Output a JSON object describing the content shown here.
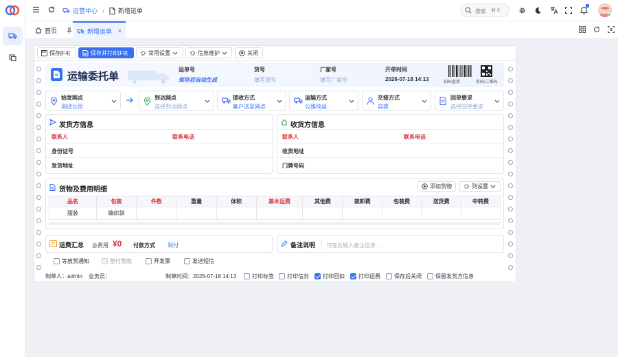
{
  "sidebar": {
    "logo": "app-logo",
    "items": [
      {
        "icon": "truck-icon",
        "active": true
      },
      {
        "icon": "copy-window-icon",
        "active": false
      }
    ]
  },
  "header": {
    "breadcrumb": [
      {
        "label": "运营中心",
        "icon": "truck-icon"
      },
      {
        "label": "新增运单",
        "icon": "document-icon"
      }
    ],
    "search_placeholder": "搜索",
    "search_shortcut": "⌘ K",
    "icons": [
      "gear-icon",
      "moon-icon",
      "translate-icon",
      "fullscreen-icon",
      "bell-icon",
      "avatar"
    ]
  },
  "tabs": [
    {
      "label": "首页",
      "icon": "home-icon",
      "active": false
    },
    {
      "label": "新增运单",
      "icon": "truck-icon",
      "active": true,
      "closable": true
    }
  ],
  "toolbar": {
    "save": "保存[F4]",
    "save_print": "保存并打印[F9]",
    "common_settings": "常用设置",
    "info_maintain": "信息维护",
    "close": "关闭"
  },
  "form": {
    "title": "运输委托单",
    "waybill_no": {
      "label": "运单号",
      "value": "保存后自动生成"
    },
    "goods_no": {
      "label": "货号",
      "placeholder": "填写货号"
    },
    "factory_no": {
      "label": "厂家号",
      "placeholder": "填写厂家号"
    },
    "open_time": {
      "label": "开单时间",
      "value": "2026-07-18 14:13"
    },
    "scan_label": "扫码查单",
    "barcode_label": "条码/二维码",
    "route": [
      {
        "label": "始发网点",
        "value": "测试公司",
        "placeholder": ""
      },
      {
        "label": "到达网点",
        "value": "",
        "placeholder": "选择到达网点"
      },
      {
        "label": "提收方式",
        "value": "客户送至网点",
        "placeholder": ""
      },
      {
        "label": "运输方式",
        "value": "公路快运",
        "placeholder": ""
      },
      {
        "label": "交接方式",
        "value": "自提",
        "placeholder": ""
      },
      {
        "label": "回单要求",
        "value": "",
        "placeholder": "选择回单要求"
      }
    ],
    "shipper": {
      "title": "发货方信息",
      "contact": "联系人",
      "phone": "联系电话",
      "id_card": "身份证号",
      "address": "发货地址"
    },
    "receiver": {
      "title": "收货方信息",
      "contact": "联系人",
      "phone": "联系电话",
      "address": "收货地址",
      "door_no": "门牌号码"
    },
    "goods": {
      "title": "货物及费用明细",
      "add_button": "添加货物",
      "column_settings": "列设置",
      "columns": [
        "品名",
        "包装",
        "件数",
        "重量",
        "体积",
        "基本运费",
        "其他费",
        "装卸费",
        "包装费",
        "送货费",
        "中转费"
      ],
      "required_columns": [
        0,
        1,
        2,
        5
      ],
      "rows": [
        [
          "服装",
          "编织袋",
          "",
          "",
          "",
          "",
          "",
          "",
          "",
          "",
          ""
        ]
      ]
    },
    "summary": {
      "title": "运费汇总",
      "total_label": "总费用",
      "total_value": "¥0",
      "pay_label": "付款方式",
      "pay_value": "到付"
    },
    "remark": {
      "title": "备注说明",
      "placeholder": "可在此输入备注信息..."
    },
    "options": [
      {
        "label": "等放货通知",
        "checked": false,
        "disabled": false
      },
      {
        "label": "垫付货款",
        "checked": false,
        "disabled": true
      },
      {
        "label": "开发票",
        "checked": false,
        "disabled": false
      },
      {
        "label": "发送短信",
        "checked": false,
        "disabled": false
      }
    ],
    "footer": {
      "creator": "制单人：admin",
      "salesman": "业务员：",
      "created_time": "制单时间：2026-07-18 14:13",
      "prints": [
        {
          "label": "打印标签",
          "checked": false
        },
        {
          "label": "打印信封",
          "checked": false
        },
        {
          "label": "打印回扣",
          "checked": true
        },
        {
          "label": "打印运费",
          "checked": true
        },
        {
          "label": "保存后关闭",
          "checked": false
        },
        {
          "label": "保留发货方信息",
          "checked": false
        }
      ]
    }
  },
  "colors": {
    "accent": "#3a6ff0",
    "required": "#d9363e",
    "price": "#d9363e"
  }
}
